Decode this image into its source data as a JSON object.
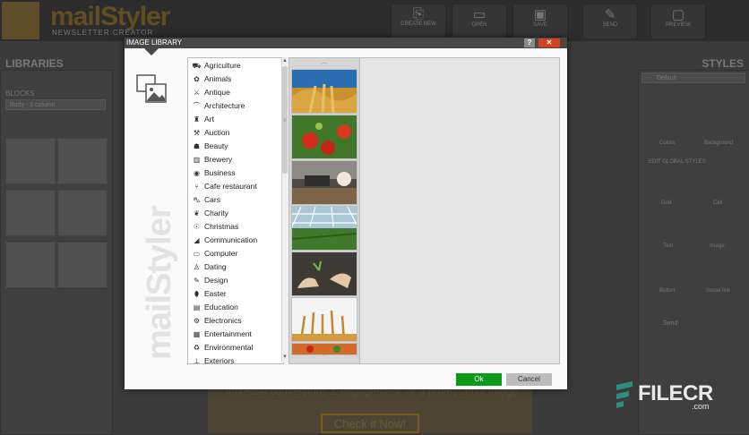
{
  "app": {
    "logo": "mailStyler",
    "logo_sub": "NEWSLETTER CREATOR"
  },
  "background": {
    "toolbar": [
      "CREATE NEW",
      "OPEN",
      "SAVE",
      "SEND",
      "PREVIEW"
    ],
    "libraries_title": "LIBRARIES",
    "styles_title": "STYLES",
    "blocks_label": "BLOCKS",
    "blocks_select": "Body - 1 column",
    "style_select": "Default",
    "style_items": [
      "Colors",
      "Background",
      "Grid",
      "Cell",
      "Text",
      "Image",
      "Button",
      "Social link"
    ],
    "global_styles": "EDIT GLOBAL STYLES",
    "send_label": "Send",
    "sentence": "Increase conversions & engagement for a professional image",
    "cta": "Check it Now!"
  },
  "dialog": {
    "title": "IMAGE LIBRARY",
    "help": "?",
    "close": "✕",
    "watermark": "mailStyler",
    "categories": [
      {
        "label": "Agriculture",
        "icon": "tractor-icon",
        "glyph": "⛟"
      },
      {
        "label": "Animals",
        "icon": "paw-icon",
        "glyph": "✿"
      },
      {
        "label": "Antique",
        "icon": "swords-icon",
        "glyph": "⚔"
      },
      {
        "label": "Architecture",
        "icon": "bridge-icon",
        "glyph": "⌒"
      },
      {
        "label": "Art",
        "icon": "art-icon",
        "glyph": "♜"
      },
      {
        "label": "Auction",
        "icon": "gavel-icon",
        "glyph": "⚒"
      },
      {
        "label": "Beauty",
        "icon": "beauty-icon",
        "glyph": "☗"
      },
      {
        "label": "Brewery",
        "icon": "beer-icon",
        "glyph": "▥"
      },
      {
        "label": "Business",
        "icon": "business-icon",
        "glyph": "◉"
      },
      {
        "label": "Cafe restaurant",
        "icon": "fork-knife-icon",
        "glyph": "⑂"
      },
      {
        "label": "Cars",
        "icon": "car-icon",
        "glyph": "⛍"
      },
      {
        "label": "Charity",
        "icon": "charity-icon",
        "glyph": "❦"
      },
      {
        "label": "Christmas",
        "icon": "ornament-icon",
        "glyph": "☉"
      },
      {
        "label": "Communication",
        "icon": "megaphone-icon",
        "glyph": "◢"
      },
      {
        "label": "Computer",
        "icon": "monitor-icon",
        "glyph": "▭"
      },
      {
        "label": "Dating",
        "icon": "dating-icon",
        "glyph": "♙"
      },
      {
        "label": "Design",
        "icon": "design-icon",
        "glyph": "✎"
      },
      {
        "label": "Easter",
        "icon": "easter-egg-icon",
        "glyph": "⬮"
      },
      {
        "label": "Education",
        "icon": "book-icon",
        "glyph": "▤"
      },
      {
        "label": "Electronics",
        "icon": "chip-icon",
        "glyph": "⚙"
      },
      {
        "label": "Entertainment",
        "icon": "film-icon",
        "glyph": "▦"
      },
      {
        "label": "Environmental",
        "icon": "recycle-icon",
        "glyph": "♻"
      },
      {
        "label": "Exteriors",
        "icon": "exteriors-icon",
        "glyph": "⊥"
      }
    ],
    "images": [
      "wheat-field-image",
      "tomatoes-image",
      "harvester-image",
      "greenhouse-image",
      "planting-hands-image",
      "wheat-ears-image"
    ],
    "ok_label": "Ok",
    "cancel_label": "Cancel"
  },
  "watermark_brand": {
    "name": "FILECR",
    "tld": ".com"
  },
  "colors": {
    "ok": "#0b9a1b",
    "close": "#d2421c",
    "brand": "#7a5a1d"
  }
}
